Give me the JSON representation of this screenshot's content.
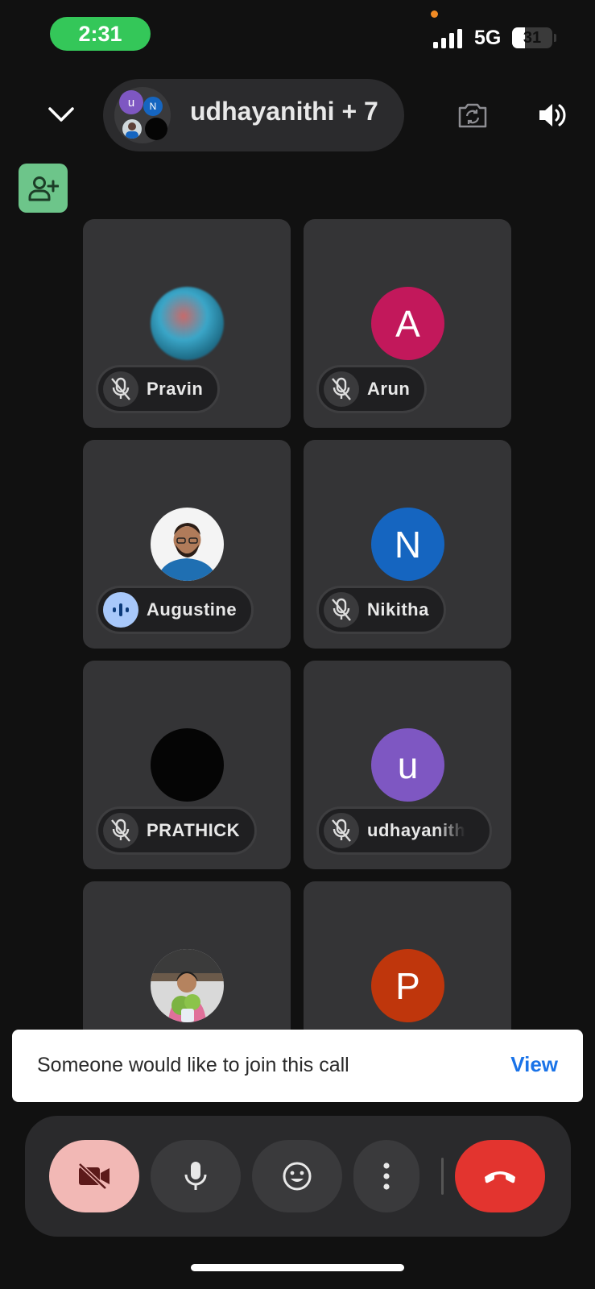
{
  "status_bar": {
    "time": "2:31",
    "network": "5G",
    "battery_level": "31",
    "battery_fraction": 0.31
  },
  "header": {
    "title": "udhayanithi + 7",
    "cluster": {
      "top_left_initial": "u",
      "top_left_color": "#7e57c2",
      "top_right_initial": "N",
      "top_right_color": "#1565c0"
    },
    "icons": {
      "collapse": "chevron-down-icon",
      "flip_camera": "flip-camera-icon",
      "speaker": "speaker-icon",
      "add_person": "add-person-icon"
    }
  },
  "participants": [
    {
      "name": "Pravin",
      "avatar_type": "photo-blurred",
      "mic": "muted"
    },
    {
      "name": "Arun",
      "avatar_type": "initial",
      "initial": "A",
      "color": "#c2185b",
      "mic": "muted"
    },
    {
      "name": "Augustine",
      "avatar_type": "photo",
      "mic": "speaking"
    },
    {
      "name": "Nikitha",
      "avatar_type": "initial",
      "initial": "N",
      "color": "#1565c0",
      "mic": "muted"
    },
    {
      "name": "PRATHICK",
      "avatar_type": "photo-dark",
      "mic": "muted"
    },
    {
      "name": "udhayanith",
      "avatar_type": "initial",
      "initial": "u",
      "color": "#7e57c2",
      "mic": "muted"
    },
    {
      "name": "",
      "avatar_type": "photo",
      "mic": ""
    },
    {
      "name": "",
      "avatar_type": "initial",
      "initial": "P",
      "color": "#bf360c",
      "mic": ""
    }
  ],
  "toast": {
    "message": "Someone would like to join this call",
    "action": "View"
  },
  "controls": {
    "camera": {
      "icon": "camera-off-icon",
      "bg": "#f2b8b5",
      "state": "off"
    },
    "mic": {
      "icon": "mic-icon",
      "bg": "#3a3a3c"
    },
    "emoji": {
      "icon": "emoji-icon",
      "bg": "#3a3a3c"
    },
    "more": {
      "icon": "more-vertical-icon",
      "bg": "#3a3a3c"
    },
    "end_call": {
      "icon": "end-call-icon",
      "bg": "#e3342f"
    }
  },
  "colors": {
    "background": "#111111",
    "tile": "#343436",
    "accent_green": "#34c759",
    "link_blue": "#1a73e8"
  }
}
